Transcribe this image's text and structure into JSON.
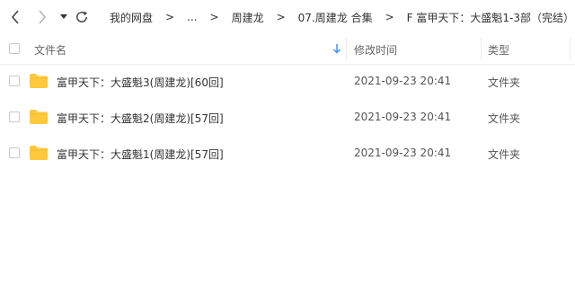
{
  "toolbar": {
    "back_icon": "chevron-left-icon",
    "forward_icon": "chevron-right-icon",
    "dropdown_icon": "caret-down-icon",
    "refresh_icon": "refresh-icon"
  },
  "breadcrumb": {
    "items": [
      "我的网盘",
      "...",
      "周建龙",
      "07.周建龙 合集",
      "F 富甲天下：大盛魁1-3部（完结）"
    ],
    "separator": ">"
  },
  "columns": {
    "name": "文件名",
    "date": "修改时间",
    "type": "类型",
    "sort_icon": "sort-down-arrow-icon"
  },
  "files": [
    {
      "name": "富甲天下：大盛魁3(周建龙)[60回]",
      "date": "2021-09-23 20:41",
      "type": "文件夹",
      "icon": "folder-icon"
    },
    {
      "name": "富甲天下：大盛魁2(周建龙)[57回]",
      "date": "2021-09-23 20:41",
      "type": "文件夹",
      "icon": "folder-icon"
    },
    {
      "name": "富甲天下：大盛魁1(周建龙)[57回]",
      "date": "2021-09-23 20:41",
      "type": "文件夹",
      "icon": "folder-icon"
    }
  ],
  "colors": {
    "folder": "#FFC83D",
    "sort_arrow": "#3B8CFF",
    "text": "#333333",
    "muted": "#666666"
  }
}
